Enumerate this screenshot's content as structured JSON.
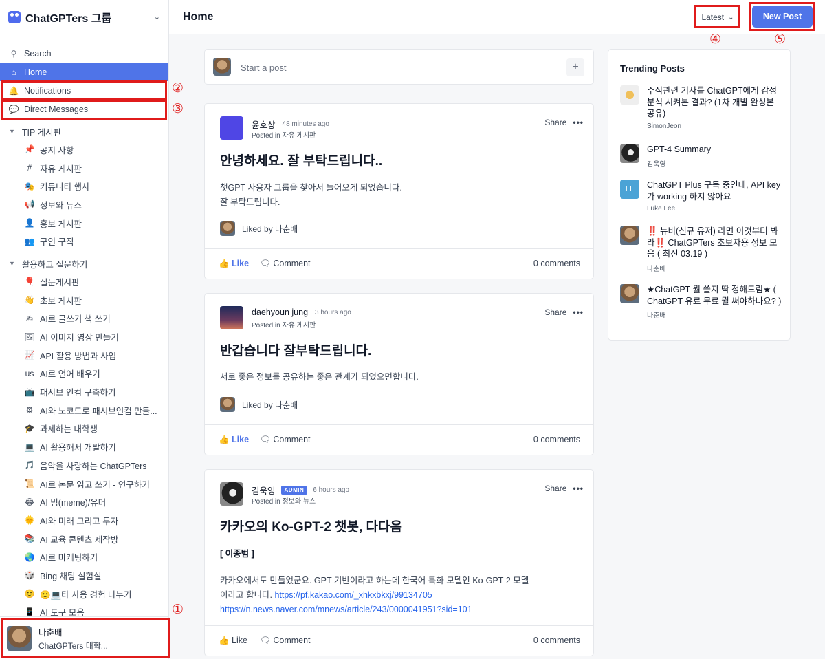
{
  "sidebar": {
    "title": "ChatGPTers 그룹",
    "nav": [
      {
        "label": "Search"
      },
      {
        "label": "Home"
      },
      {
        "label": "Notifications"
      },
      {
        "label": "Direct Messages"
      }
    ],
    "sections": [
      {
        "label": "TIP 게시판",
        "channels": [
          {
            "icon": "📌",
            "label": "공지 사항"
          },
          {
            "icon": "#",
            "label": "자유 게시판"
          },
          {
            "icon": "🎭",
            "label": "커뮤니티 행사"
          },
          {
            "icon": "📢",
            "label": "정보와 뉴스"
          },
          {
            "icon": "👤",
            "label": "홍보 게시판"
          },
          {
            "icon": "👥",
            "label": "구인 구직"
          }
        ]
      },
      {
        "label": "활용하고 질문하기",
        "channels": [
          {
            "icon": "🎈",
            "label": "질문게시판"
          },
          {
            "icon": "👋",
            "label": "초보 게시판"
          },
          {
            "icon": "✍",
            "label": "AI로 글쓰기 책 쓰기"
          },
          {
            "icon": "🖼",
            "label": "AI 이미지-영상 만들기"
          },
          {
            "icon": "📈",
            "label": "API 활용 방법과 사업"
          },
          {
            "icon": "us",
            "label": "AI로 언어 배우기"
          },
          {
            "icon": "📺",
            "label": "패시브 인컴 구축하기"
          },
          {
            "icon": "⚙",
            "label": "AI와 노코드로 패시브인컴 만들..."
          },
          {
            "icon": "🎓",
            "label": "과제하는 대학생"
          },
          {
            "icon": "💻",
            "label": "AI 활용해서 개발하기"
          },
          {
            "icon": "🎵",
            "label": "음악을 사랑하는 ChatGPTers"
          },
          {
            "icon": "📜",
            "label": "AI로 논문 읽고 쓰기 - 연구하기"
          },
          {
            "icon": "😂",
            "label": "AI 밈(meme)/유머"
          },
          {
            "icon": "🌞",
            "label": "AI와 미래 그리고 투자"
          },
          {
            "icon": "📚",
            "label": "AI 교육 콘텐츠 제작방"
          },
          {
            "icon": "🌏",
            "label": "AI로 마케팅하기"
          },
          {
            "icon": "🎲",
            "label": "Bing 채팅 실험실"
          },
          {
            "icon": "🙂",
            "label": "🙂💻타 사용 경험 나누기"
          },
          {
            "icon": "📱",
            "label": "AI 도구 모음"
          }
        ]
      }
    ],
    "user": {
      "name": "나춘배",
      "subtitle": "ChatGPTers 대학..."
    }
  },
  "topbar": {
    "title": "Home",
    "sort_label": "Latest",
    "sort_chevron": "⌄",
    "new_post_label": "New Post"
  },
  "annotations": [
    "①",
    "②",
    "③",
    "④",
    "⑤"
  ],
  "composer": {
    "placeholder": "Start a post",
    "plus": "+"
  },
  "posts": [
    {
      "author": "윤호상",
      "time": "48 minutes ago",
      "posted_in": "Posted in 자유 게시판",
      "title": "안녕하세요. 잘 부탁드립니다..",
      "body": [
        "챗GPT 사용자 그룹을 찾아서 들어오게 되었습니다.",
        "잘 부탁드립니다."
      ],
      "liked_by": "Liked by 나춘배",
      "like_label": "Like",
      "comment_label": "Comment",
      "comments": "0 comments",
      "share_label": "Share"
    },
    {
      "author": "daehyoun jung",
      "time": "3 hours ago",
      "posted_in": "Posted in 자유 게시판",
      "title": "반갑습니다 잘부탁드립니다.",
      "body": [
        "서로 좋은 정보를 공유하는 좋은 관계가 되었으면합니다."
      ],
      "liked_by": "Liked by 나춘배",
      "like_label": "Like",
      "comment_label": "Comment",
      "comments": "0 comments",
      "share_label": "Share"
    },
    {
      "author": "김욱영",
      "badge": "ADMIN",
      "time": "6 hours ago",
      "posted_in": "Posted in 정보와 뉴스",
      "title": "카카오의 Ko-GPT-2 챗봇, 다다음",
      "subhead": "[ 이종범 ]",
      "body": [
        "카카오에서도 만들었군요. GPT 기반이라고 하는데 한국어 특화 모델인 Ko-GPT-2 모델",
        "이라고 합니다."
      ],
      "link1": "https://pf.kakao.com/_xhkxbkxj/99134705",
      "link2": "https://n.news.naver.com/mnews/article/243/0000041951?sid=101",
      "like_label": "Like",
      "comment_label": "Comment",
      "comments": "0 comments",
      "share_label": "Share"
    }
  ],
  "trending": {
    "title": "Trending Posts",
    "items": [
      {
        "title": "주식관련 기사를 ChatGPT에게 감성분석 시켜본 결과? (1차 개발 완성본 공유)",
        "author": "SimonJeon"
      },
      {
        "title": "GPT-4 Summary",
        "author": "김욱영"
      },
      {
        "title": "ChatGPT Plus 구독 중인데, API key가 working 하지 않아요",
        "author": "Luke Lee",
        "initials": "LL"
      },
      {
        "title": "‼️ 뉴비(신규 유저) 라면 이것부터 봐라‼️ ChatGPTers 초보자용 정보 모음 ( 최신 03.19 )",
        "author": "나춘배"
      },
      {
        "title": "★ChatGPT 뭘 쓸지 딱 정해드림★ ( ChatGPT 유료 무료 뭘 써야하나요? )",
        "author": "나춘배"
      }
    ]
  }
}
